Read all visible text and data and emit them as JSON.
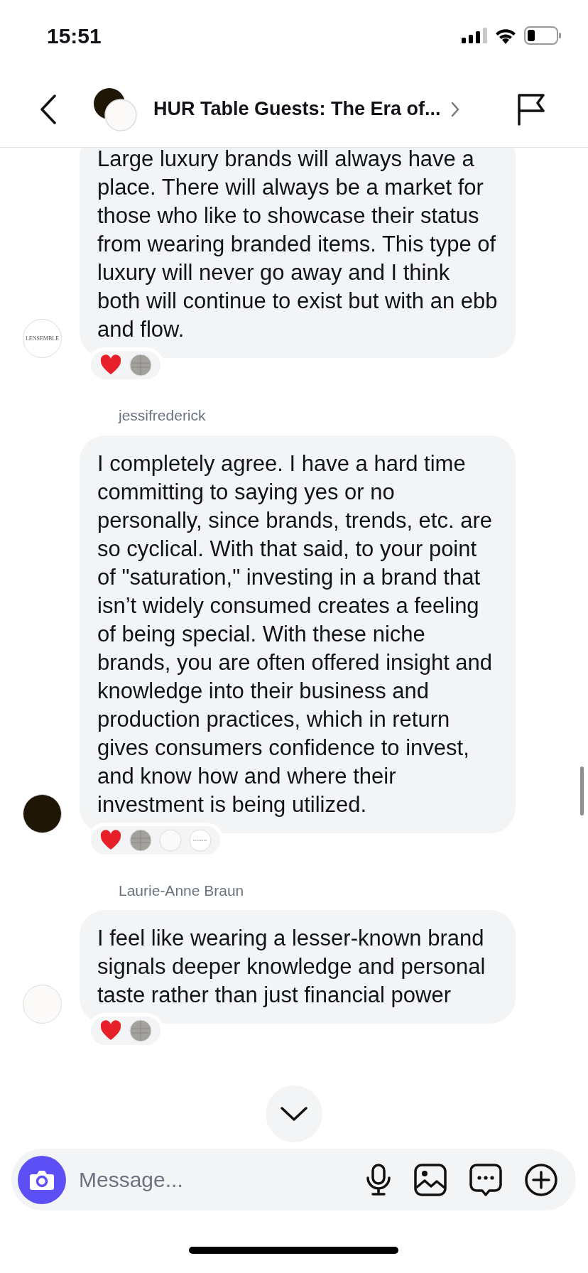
{
  "status_bar": {
    "time": "15:51"
  },
  "header": {
    "title": "HUR Table Guests: The Era of..."
  },
  "messages": [
    {
      "avatar": {
        "kind": "logo",
        "text": "LENSEMBLE",
        "color": "#ffffff"
      },
      "text": "Large luxury brands will always have a place. There will always be a market for those who like to showcase their status from wearing branded items. This type of luxury will never go away and I think both will continue to exist but with an ebb and flow.",
      "reactions": [
        {
          "kind": "heart"
        },
        {
          "kind": "avatar",
          "color": "#a3a19c"
        }
      ]
    },
    {
      "author": "jessifrederick",
      "avatar": {
        "kind": "plain",
        "color": "#1f1606"
      },
      "text": "I completely agree. I have a hard time committing to saying yes or no personally, since brands, trends, etc. are so cyclical. With that said, to your point of \"saturation,\" investing in a brand that isn’t widely consumed creates a feeling of being special. With these niche brands, you are often offered insight and knowledge into their business and production practices, which in return gives consumers confidence to invest, and know how and where their investment is being utilized.",
      "reactions": [
        {
          "kind": "heart"
        },
        {
          "kind": "avatar",
          "color": "#a3a19c"
        },
        {
          "kind": "avatar",
          "color": "#fbfaf8"
        },
        {
          "kind": "logo",
          "color": "#ffffff"
        }
      ]
    },
    {
      "author": "Laurie-Anne Braun",
      "avatar": {
        "kind": "plain",
        "color": "#fbfaf8"
      },
      "text": "I feel like wearing a lesser-known brand signals deeper knowledge and personal taste rather than just financial power",
      "reactions": [
        {
          "kind": "heart"
        },
        {
          "kind": "avatar",
          "color": "#a3a19c"
        }
      ]
    }
  ],
  "composer": {
    "placeholder": "Message..."
  }
}
